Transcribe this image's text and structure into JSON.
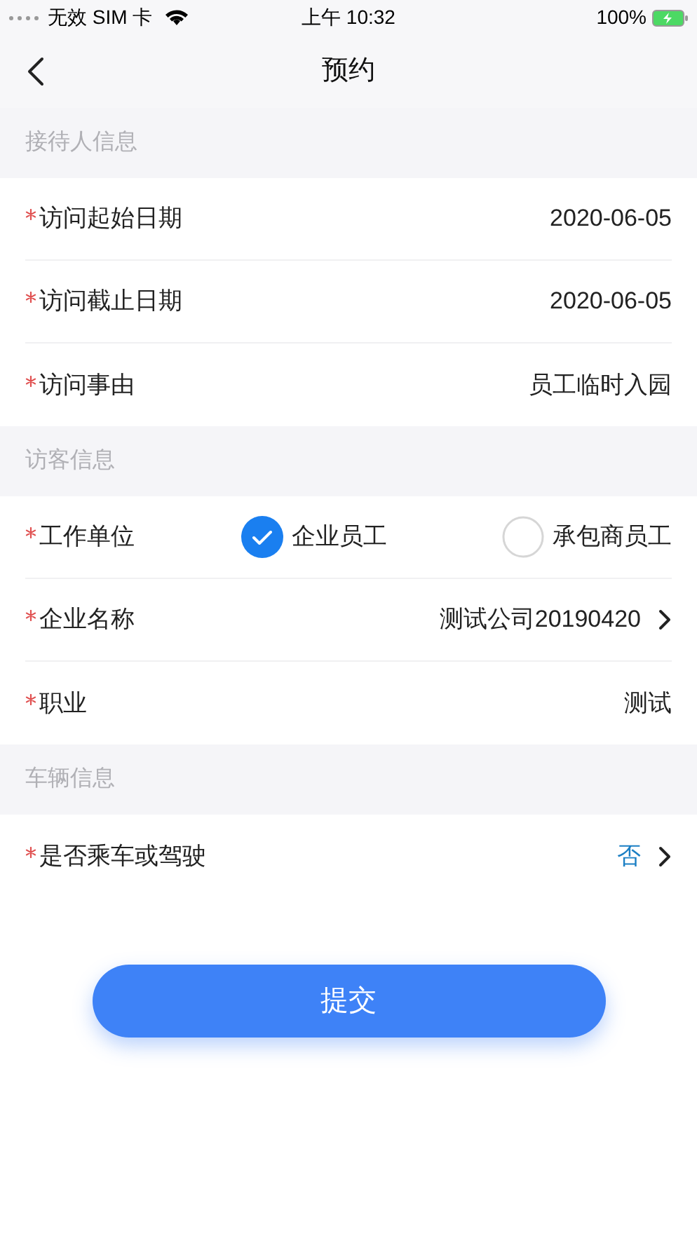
{
  "status_bar": {
    "carrier": "无效 SIM 卡",
    "time": "上午 10:32",
    "battery": "100%"
  },
  "nav": {
    "title": "预约"
  },
  "sections": [
    {
      "title": "接待人信息",
      "rows": [
        {
          "kind": "value",
          "label": "访问起始日期",
          "required": true,
          "value": "2020-06-05",
          "highlight": false
        },
        {
          "kind": "value",
          "label": "访问截止日期",
          "required": true,
          "value": "2020-06-05",
          "highlight": false
        },
        {
          "kind": "value",
          "label": "访问事由",
          "required": true,
          "value": "员工临时入园",
          "highlight": false
        }
      ]
    },
    {
      "title": "访客信息",
      "rows": [
        {
          "kind": "radio",
          "label": "工作单位",
          "required": true,
          "options": [
            {
              "label": "企业员工",
              "selected": true
            },
            {
              "label": "承包商员工",
              "selected": false
            }
          ]
        },
        {
          "kind": "select",
          "label": "企业名称",
          "required": true,
          "value": "测试公司20190420",
          "highlight": false
        },
        {
          "kind": "value",
          "label": "职业",
          "required": true,
          "value": "测试",
          "highlight": false
        }
      ]
    },
    {
      "title": "车辆信息",
      "rows": [
        {
          "kind": "select",
          "label": "是否乘车或驾驶",
          "required": true,
          "value": "否",
          "highlight": true
        }
      ]
    }
  ],
  "submit": {
    "label": "提交"
  }
}
